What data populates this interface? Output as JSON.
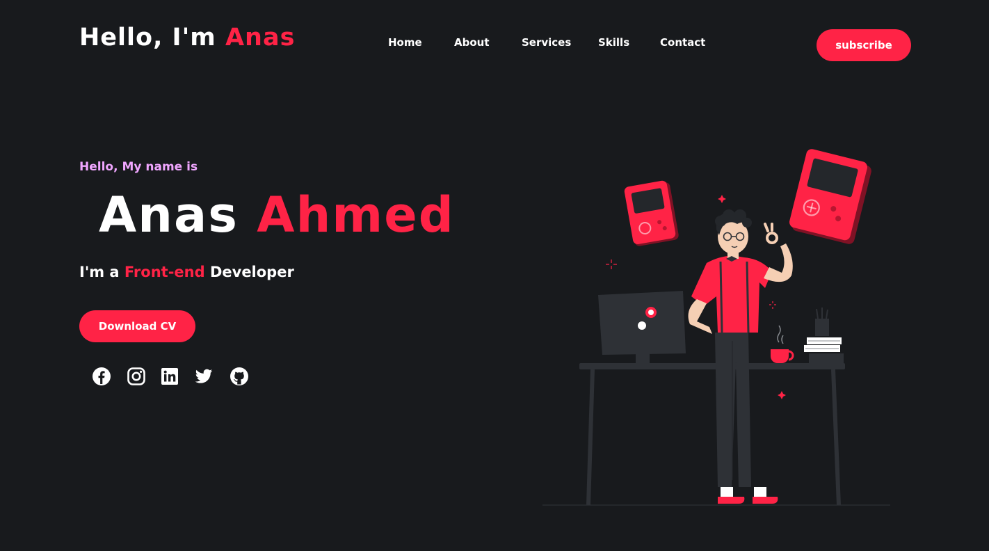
{
  "logo": {
    "prefix": "Hello, I'm",
    "highlight": "Anas"
  },
  "nav": {
    "items": [
      {
        "label": "Home"
      },
      {
        "label": "About"
      },
      {
        "label": "Services"
      },
      {
        "label": "Skills"
      },
      {
        "label": "Contact"
      }
    ]
  },
  "subscribe_label": "subscribe",
  "hero": {
    "greeting": "Hello, My name is",
    "first_name": "Anas",
    "last_name": "Ahmed",
    "role_prefix": "I'm a",
    "role_highlight": "Front-end",
    "role_suffix": "Developer",
    "cta_label": "Download CV"
  },
  "social": [
    {
      "icon": "facebook-icon"
    },
    {
      "icon": "instagram-icon"
    },
    {
      "icon": "linkedin-icon"
    },
    {
      "icon": "twitter-icon"
    },
    {
      "icon": "github-icon"
    }
  ],
  "colors": {
    "background": "#181a1d",
    "accent": "#ff2346",
    "greeting": "#f0a6ff",
    "text": "#ffffff"
  }
}
